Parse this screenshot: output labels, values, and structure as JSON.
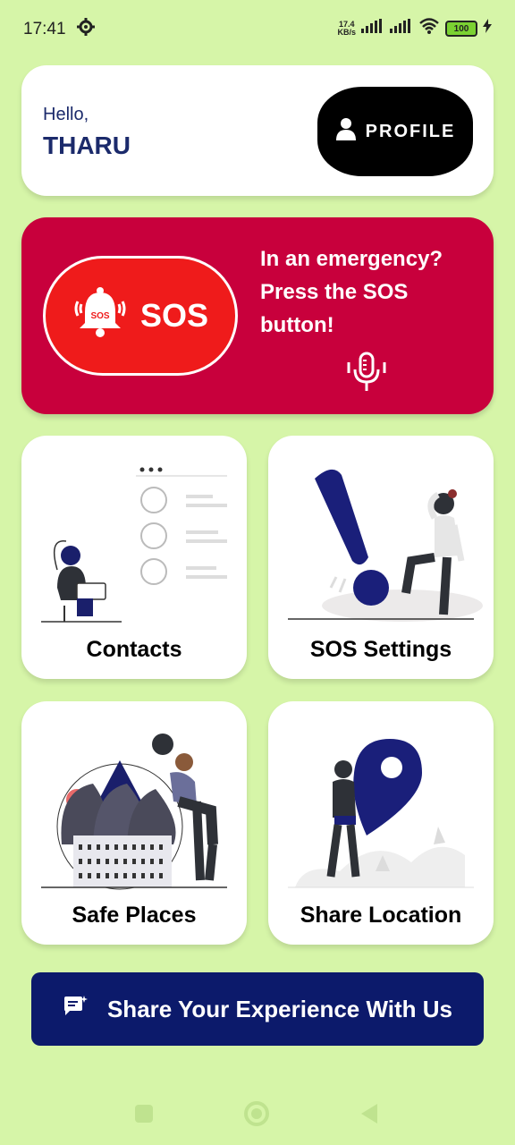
{
  "status_bar": {
    "time": "17:41",
    "speed_value": "17.4",
    "speed_unit": "KB/s",
    "battery": "100"
  },
  "greeting": {
    "hello": "Hello,",
    "name": "THARU",
    "profile_label": "PROFILE"
  },
  "sos": {
    "button_label": "SOS",
    "bell_badge": "SOS",
    "message": "In an emergency? Press the SOS button!"
  },
  "tiles": [
    {
      "label": "Contacts"
    },
    {
      "label": "SOS Settings"
    },
    {
      "label": "Safe Places"
    },
    {
      "label": "Share Location"
    }
  ],
  "share_button": {
    "label": "Share Your Experience With Us"
  },
  "colors": {
    "background": "#d6f5a8",
    "sos_panel": "#c8003c",
    "sos_button": "#ef1b1b",
    "navy": "#0c1a6b"
  }
}
